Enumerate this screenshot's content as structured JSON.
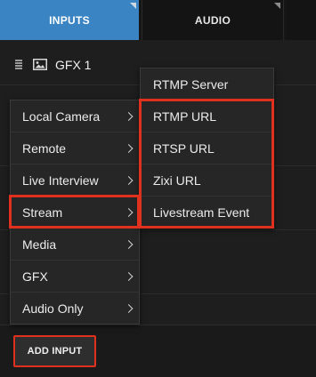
{
  "tabs": {
    "inputs_label": "INPUTS",
    "audio_label": "AUDIO"
  },
  "input_row": {
    "label": "GFX 1",
    "drag_icon": "drag-handle-icon",
    "type_icon": "image-icon"
  },
  "menu": {
    "items": [
      {
        "label": "Local Camera"
      },
      {
        "label": "Remote"
      },
      {
        "label": "Live Interview"
      },
      {
        "label": "Stream",
        "highlighted": true
      },
      {
        "label": "Media"
      },
      {
        "label": "GFX"
      },
      {
        "label": "Audio Only"
      }
    ]
  },
  "submenu": {
    "items": [
      {
        "label": "RTMP Server"
      },
      {
        "label": "RTMP URL",
        "highlighted": true
      },
      {
        "label": "RTSP URL",
        "highlighted": true
      },
      {
        "label": "Zixi URL",
        "highlighted": true
      },
      {
        "label": "Livestream Event",
        "highlighted": true
      }
    ]
  },
  "footer": {
    "add_input_label": "ADD INPUT"
  },
  "colors": {
    "accent": "#3b84c4",
    "highlight": "#e0301e",
    "background": "#1e1e1e"
  }
}
